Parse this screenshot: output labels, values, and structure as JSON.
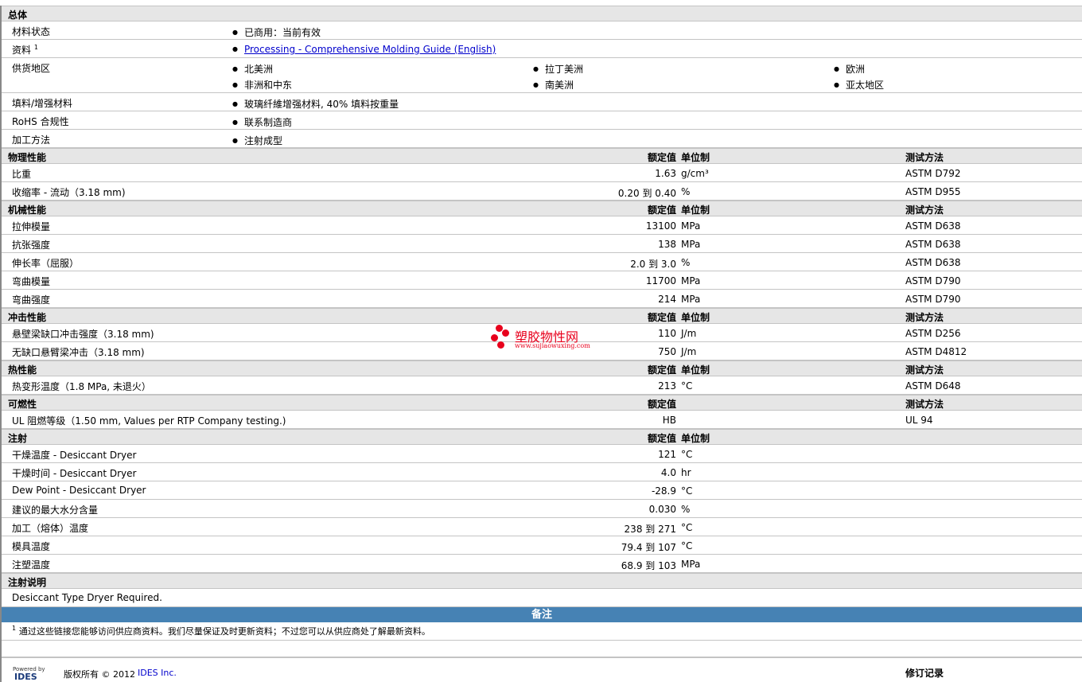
{
  "general": {
    "title": "总体",
    "rows": [
      {
        "label": "材料状态",
        "items": [
          "已商用：当前有效"
        ]
      },
      {
        "label": "资料",
        "sup": "1",
        "link": "Processing - Comprehensive Molding Guide (English)"
      },
      {
        "label": "供货地区",
        "items": [
          "北美洲",
          "拉丁美洲",
          "欧洲",
          "非洲和中东",
          "南美洲",
          "亚太地区"
        ]
      },
      {
        "label": "填料/增强材料",
        "items": [
          "玻璃纤維增强材料, 40% 填料按重量"
        ]
      },
      {
        "label": "RoHS 合规性",
        "items": [
          "联系制造商"
        ]
      },
      {
        "label": "加工方法",
        "items": [
          "注射成型"
        ]
      }
    ]
  },
  "sections": [
    {
      "title": "物理性能",
      "h_val": "额定值",
      "h_unit": "单位制",
      "h_test": "测试方法",
      "rows": [
        {
          "label": "比重",
          "value": "1.63",
          "unit": "g/cm³",
          "test": "ASTM D792"
        },
        {
          "label": "收缩率  - 流动（3.18 mm)",
          "value": "0.20 到  0.40",
          "unit": "%",
          "test": "ASTM D955"
        }
      ]
    },
    {
      "title": "机械性能",
      "h_val": "额定值",
      "h_unit": "单位制",
      "h_test": "测试方法",
      "rows": [
        {
          "label": "拉伸模量",
          "value": "13100",
          "unit": "MPa",
          "test": "ASTM D638"
        },
        {
          "label": "抗张强度",
          "value": "138",
          "unit": "MPa",
          "test": "ASTM D638"
        },
        {
          "label": "伸长率（屈服）",
          "value": "2.0 到  3.0",
          "unit": "%",
          "test": "ASTM D638"
        },
        {
          "label": "弯曲模量",
          "value": "11700",
          "unit": "MPa",
          "test": "ASTM D790"
        },
        {
          "label": "弯曲强度",
          "value": "214",
          "unit": "MPa",
          "test": "ASTM D790"
        }
      ]
    },
    {
      "title": "冲击性能",
      "h_val": "额定值",
      "h_unit": "单位制",
      "h_test": "测试方法",
      "rows": [
        {
          "label": "悬壁梁缺口冲击强度（3.18 mm)",
          "value": "110",
          "unit": "J/m",
          "test": "ASTM D256"
        },
        {
          "label": "无缺口悬臂梁冲击（3.18 mm)",
          "value": "750",
          "unit": "J/m",
          "test": "ASTM D4812"
        }
      ]
    },
    {
      "title": "热性能",
      "h_val": "额定值",
      "h_unit": "单位制",
      "h_test": "测试方法",
      "rows": [
        {
          "label": "热变形温度（1.8 MPa, 未退火）",
          "value": "213",
          "unit": "°C",
          "test": "ASTM D648"
        }
      ]
    },
    {
      "title": "可燃性",
      "h_val": "额定值",
      "h_test": "测试方法",
      "rows": [
        {
          "label": "UL 阻燃等级（1.50 mm, Values per RTP Company testing.)",
          "value": "HB",
          "test": "UL 94"
        }
      ]
    },
    {
      "title": "注射",
      "h_val": "额定值",
      "h_unit": "单位制",
      "rows": [
        {
          "label": "干燥温度  - Desiccant Dryer",
          "value": "121",
          "unit": "°C"
        },
        {
          "label": "干燥时间  - Desiccant Dryer",
          "value": "4.0",
          "unit": "hr"
        },
        {
          "label": "Dew Point - Desiccant Dryer",
          "value": "-28.9",
          "unit": "°C"
        },
        {
          "label": "建议的最大水分含量",
          "value": "0.030",
          "unit": "%"
        },
        {
          "label": "加工（熔体）温度",
          "value": "238 到  271",
          "unit": "°C"
        },
        {
          "label": "模具温度",
          "value": "79.4 到  107",
          "unit": "°C"
        },
        {
          "label": "注塑温度",
          "value": "68.9 到  103",
          "unit": "MPa"
        }
      ]
    },
    {
      "title": "注射说明",
      "rows": [
        {
          "label": "Desiccant Type Dryer Required."
        }
      ]
    }
  ],
  "notes": {
    "title": "备注",
    "sup": "1",
    "text": "通过这些链接您能够访问供应商资料。我们尽量保证及时更新资料；不过您可以从供应商处了解最新资料。"
  },
  "footer": {
    "powered": "Powered by",
    "logo": "IDES",
    "copyright": "版权所有  © 2012",
    "company": "IDES Inc.",
    "revision": "修订记录"
  },
  "watermark": {
    "name": "塑胶物性网",
    "url": "www.sujiaowuxing.com"
  }
}
